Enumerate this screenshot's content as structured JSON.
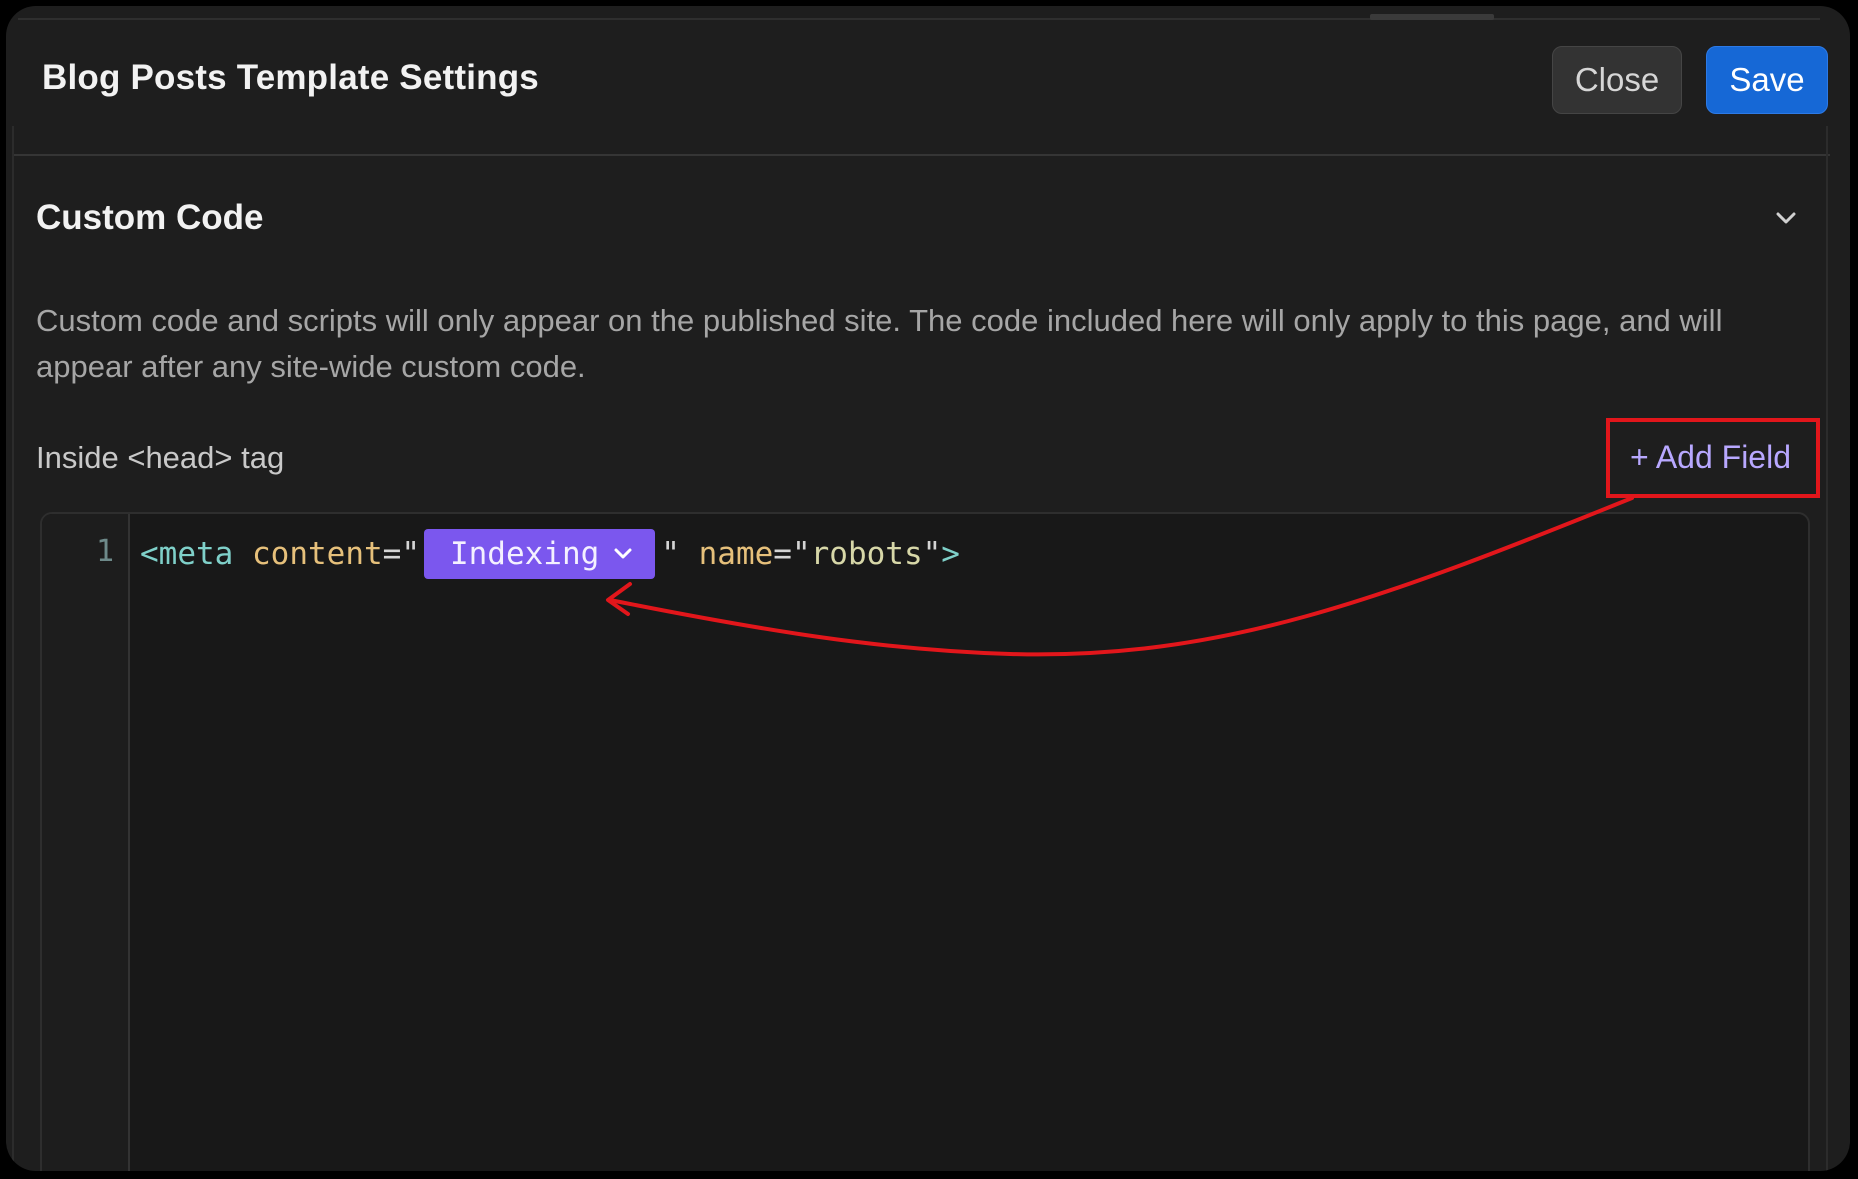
{
  "header": {
    "title": "Blog Posts Template Settings",
    "close_label": "Close",
    "save_label": "Save"
  },
  "section": {
    "title": "Custom Code",
    "description": "Custom code and scripts will only appear on the published site. The code included here will only apply to this page, and will appear after any site-wide custom code.",
    "head_label": "Inside <head> tag",
    "add_field_label": "+ Add Field"
  },
  "editor": {
    "line_number": "1",
    "tokens": {
      "tag_open": "<meta",
      "space1": " ",
      "attr_content": "content",
      "eq_quote_open": "=\"",
      "field_pill": "Indexing",
      "quote_close": "\"",
      "space2": " ",
      "attr_name": "name",
      "eq_quote_open2": "=\"",
      "value_robots": "robots",
      "quote_close2": "\"",
      "tag_close": ">"
    }
  },
  "colors": {
    "background": "#1e1e1e",
    "save_button": "#1668d6",
    "field_pill": "#7b57ee",
    "add_field_link": "#b8a8ff",
    "annotation": "#e2161b"
  },
  "icons": {
    "collapse": "chevron-down-icon",
    "pill_dropdown": "chevron-down-icon"
  }
}
